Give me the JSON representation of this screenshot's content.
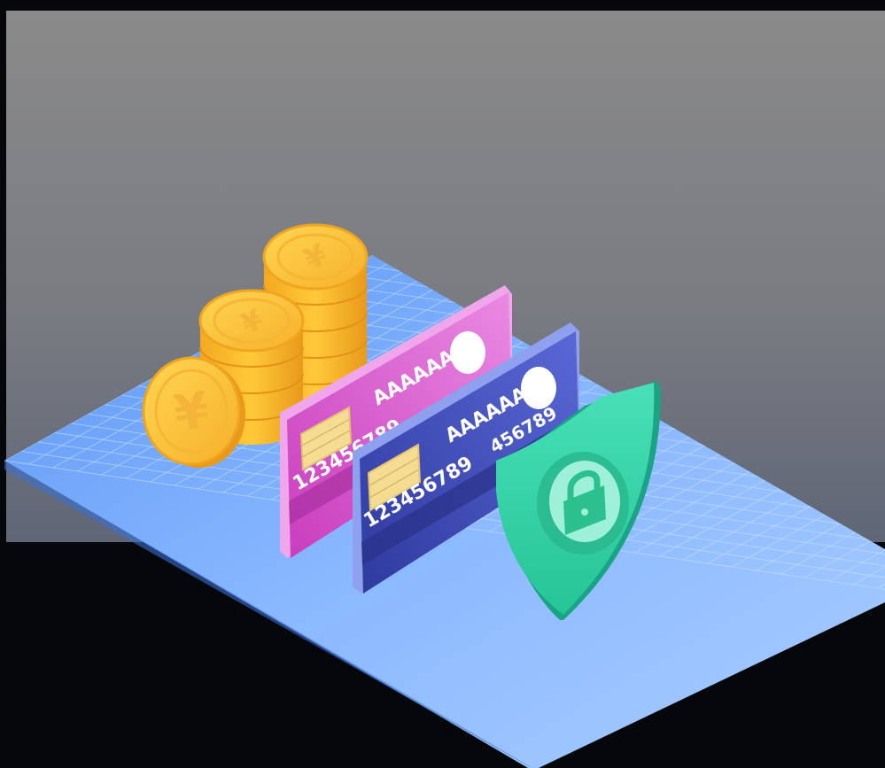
{
  "scene": {
    "colors": {
      "frame": "#06070b",
      "backdrop_top": "#8a8a8a",
      "backdrop_bottom": "#5f6676",
      "floor_light": "#9cc4ff",
      "floor_dark": "#4f8cf0",
      "coin_gold": "#f9bd2c",
      "coin_light": "#ffd653",
      "coin_dark": "#e8991a",
      "card_pink": "#d95dcf",
      "card_blue": "#3c47b0",
      "chip": "#f4dc92",
      "shield_green": "#33d4a7",
      "shield_dark": "#1aa384"
    },
    "icons": {
      "coin_symbol": "yen-icon",
      "shield_symbol": "padlock-icon"
    }
  },
  "cards": {
    "pink": {
      "name_text": "AAAAAA",
      "number_text": "123456789"
    },
    "blue": {
      "name_text": "AAAAAA",
      "number_text": "123456789",
      "number_text_short": "456789"
    }
  }
}
